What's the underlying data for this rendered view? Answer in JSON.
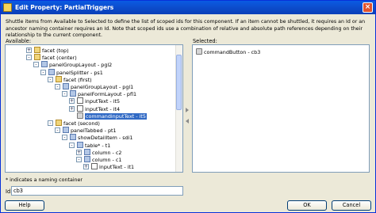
{
  "title": "Edit Property: PartialTriggers",
  "description": "Shuttle items from Available to Selected to define the list of scoped ids for this component.  If an item cannot be shuttled, it requires an Id or an ancestor naming container requires an Id. Note that scoped ids use a combination of relative and absolute path references depending on their relationship to the current component.",
  "available_label": "Available:",
  "selected_label": "Selected:",
  "tree": [
    {
      "label": "facet (top)",
      "depth": 0,
      "toggle": "+",
      "icon": "folder"
    },
    {
      "label": "facet (center)",
      "depth": 0,
      "toggle": "-",
      "icon": "folder"
    },
    {
      "label": "panelGroupLayout - pgl2",
      "depth": 1,
      "toggle": "-",
      "icon": "comp"
    },
    {
      "label": "panelSplitter - ps1",
      "depth": 2,
      "toggle": "-",
      "icon": "comp"
    },
    {
      "label": "facet (first)",
      "depth": 3,
      "toggle": "-",
      "icon": "folder"
    },
    {
      "label": "panelGroupLayout - pgl1",
      "depth": 4,
      "toggle": "-",
      "icon": "comp"
    },
    {
      "label": "panelFormLayout - pfl1",
      "depth": 5,
      "toggle": "-",
      "icon": "comp"
    },
    {
      "label": "inputText - it5",
      "depth": 6,
      "toggle": "+",
      "icon": "input"
    },
    {
      "label": "inputText - it4",
      "depth": 6,
      "toggle": "+",
      "icon": "input"
    },
    {
      "label": "commandinputText - it5",
      "depth": 6,
      "toggle": "",
      "icon": "btn",
      "selected": true
    },
    {
      "label": "facet (second)",
      "depth": 3,
      "toggle": "-",
      "icon": "folder"
    },
    {
      "label": "panelTabbed - pt1",
      "depth": 4,
      "toggle": "-",
      "icon": "comp"
    },
    {
      "label": "showDetailItem - sdi1",
      "depth": 5,
      "toggle": "-",
      "icon": "comp"
    },
    {
      "label": "table* - t1",
      "depth": 6,
      "toggle": "-",
      "icon": "comp"
    },
    {
      "label": "column - c2",
      "depth": 7,
      "toggle": "+",
      "icon": "comp"
    },
    {
      "label": "column - c1",
      "depth": 7,
      "toggle": "-",
      "icon": "comp"
    },
    {
      "label": "inputText - it1",
      "depth": 8,
      "toggle": "+",
      "icon": "input"
    }
  ],
  "selected_items": [
    "commandButton - cb3"
  ],
  "naming_note": "* indicates a naming container",
  "id_field": {
    "label": "Id:",
    "value": "cb3"
  },
  "buttons": {
    "help": "Help",
    "ok": "OK",
    "cancel": "Cancel"
  }
}
